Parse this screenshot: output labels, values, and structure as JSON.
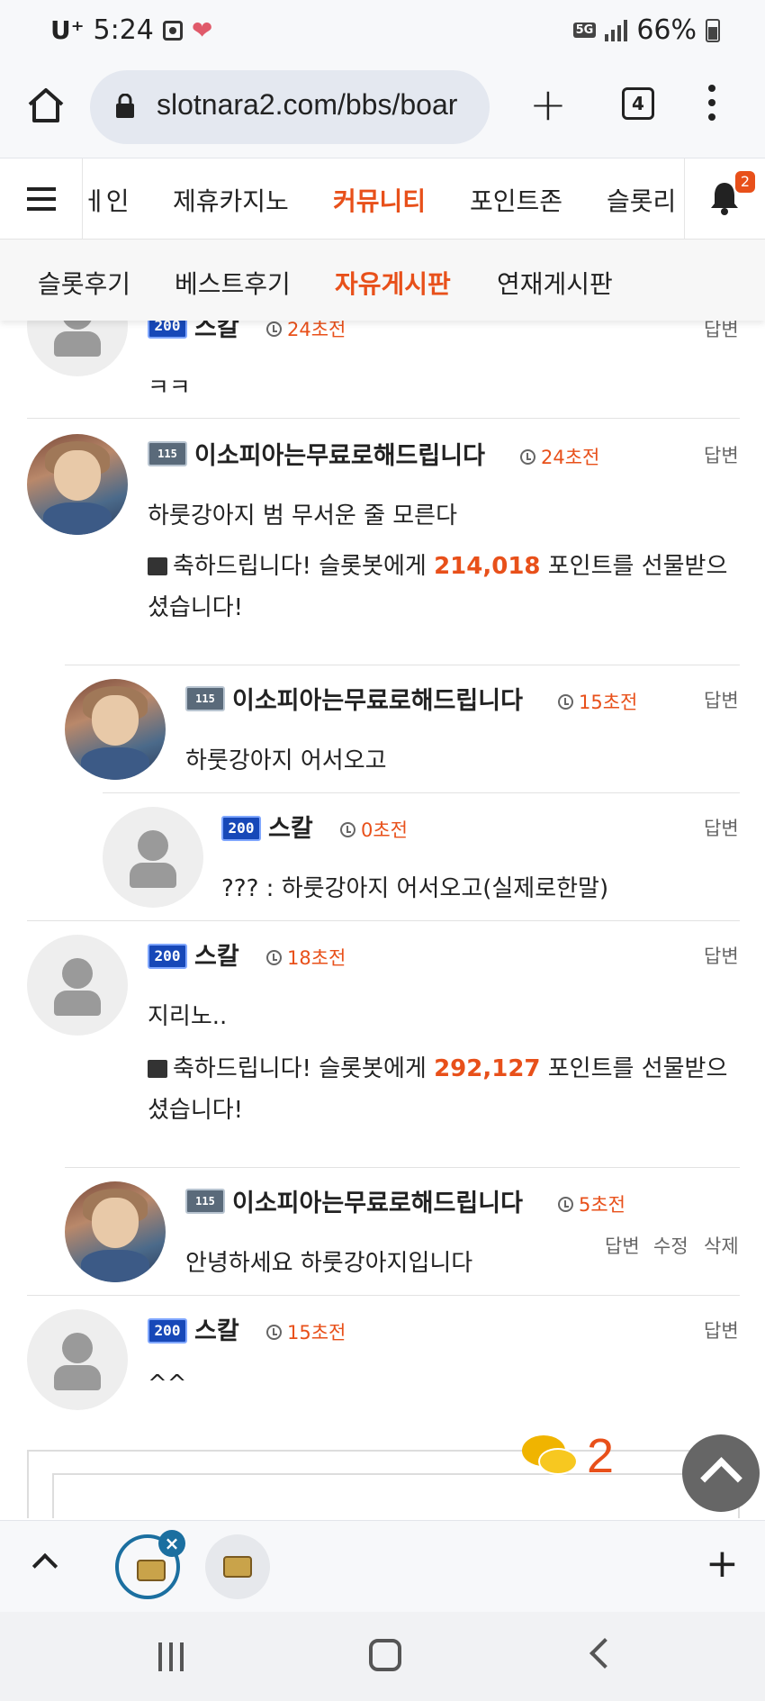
{
  "status_bar": {
    "carrier": "U⁺",
    "time": "5:24",
    "network": "5G",
    "battery": "66%"
  },
  "browser": {
    "url": "slotnara2.com/bbs/boar",
    "tab_count": "4"
  },
  "site_nav": {
    "items": [
      {
        "label": "메인",
        "shown": "ㅔ인"
      },
      {
        "label": "제휴카지노"
      },
      {
        "label": "커뮤니티",
        "active": true
      },
      {
        "label": "포인트존"
      },
      {
        "label": "슬롯리"
      }
    ],
    "notification_count": "2"
  },
  "sub_nav": {
    "items": [
      {
        "label": "슬롯후기"
      },
      {
        "label": "베스트후기"
      },
      {
        "label": "자유게시판",
        "active": true
      },
      {
        "label": "연재게시판"
      }
    ]
  },
  "comments": [
    {
      "level": "200",
      "nick": "스칼",
      "time": "24초전",
      "reply": "답변",
      "text": "ㅋㅋ"
    },
    {
      "level": "115",
      "nick": "이소피아는무료로해드립니다",
      "time": "24초전",
      "reply": "답변",
      "text": "하룻강아지 범 무서운 줄 모른다",
      "gift": {
        "prefix": "축하드립니다! 슬롯봇에게 ",
        "points": "214,018",
        "suffix": " 포인트를 선물받으",
        "line2": "셨습니다!"
      }
    },
    {
      "level": "115",
      "nick": "이소피아는무료로해드립니다",
      "time": "15초전",
      "reply": "답변",
      "text": "하룻강아지 어서오고"
    },
    {
      "level": "200",
      "nick": "스칼",
      "time": "0초전",
      "reply": "답변",
      "text": "??? : 하룻강아지 어서오고(실제로한말)"
    },
    {
      "level": "200",
      "nick": "스칼",
      "time": "18초전",
      "reply": "답변",
      "text": "지리노..",
      "gift": {
        "prefix": "축하드립니다! 슬롯봇에게 ",
        "points": "292,127",
        "suffix": " 포인트를 선물받으",
        "line2": "셨습니다!"
      }
    },
    {
      "level": "115",
      "nick": "이소피아는무료로해드립니다",
      "time": "5초전",
      "reply": "답변",
      "edit": "수정",
      "delete": "삭제",
      "text": "안녕하세요 하룻강아지입니다"
    },
    {
      "level": "200",
      "nick": "스칼",
      "time": "15초전",
      "reply": "답변",
      "text": "^^"
    }
  ],
  "chat_fab": {
    "count": "2"
  },
  "icons": [
    "home-icon",
    "lock-icon",
    "plus-icon",
    "tabs-icon",
    "more-icon",
    "hamburger-icon",
    "bell-icon",
    "clock-icon",
    "gift-icon",
    "chat-icon",
    "scroll-top-icon",
    "recents-icon",
    "home-nav-icon",
    "back-icon"
  ],
  "colors": {
    "accent": "#e8501a",
    "level_blue": "#1748b8",
    "tab_active": "#1b6fa0"
  }
}
